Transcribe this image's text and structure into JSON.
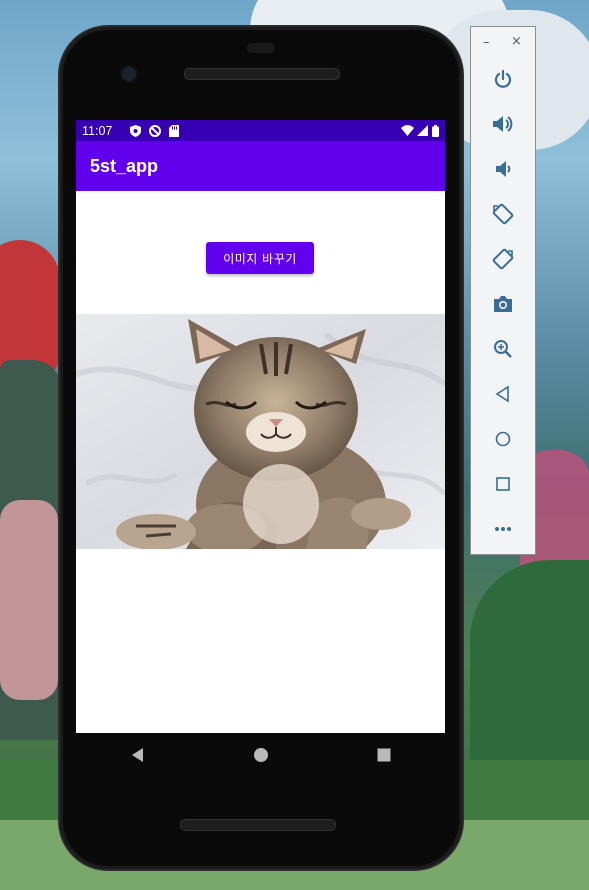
{
  "status_bar": {
    "time": "11:07"
  },
  "app": {
    "title": "5st_app"
  },
  "main": {
    "change_image_button_label": "이미지 바꾸기"
  },
  "image": {
    "alt": "kitten"
  },
  "colors": {
    "primary": "#6200ee",
    "primary_dark": "#3700b3"
  },
  "nav": {
    "icons": [
      "back-icon",
      "home-icon",
      "recents-icon"
    ]
  },
  "emulator_toolbar": {
    "minimize_label": "–",
    "close_label": "×",
    "icons": [
      "power-icon",
      "volume-up-icon",
      "volume-down-icon",
      "rotate-left-icon",
      "rotate-right-icon",
      "screenshot-icon",
      "zoom-icon",
      "back-icon",
      "home-icon",
      "overview-icon",
      "more-icon"
    ]
  }
}
